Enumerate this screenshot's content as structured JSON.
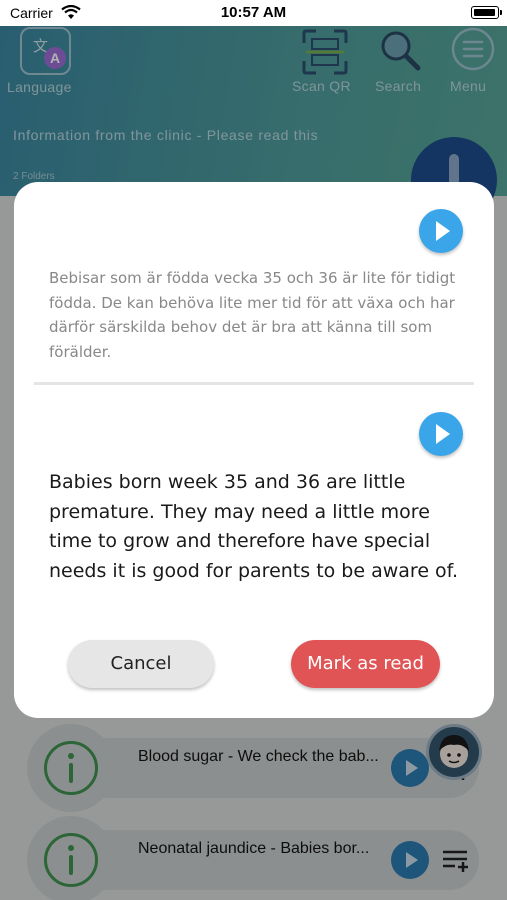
{
  "status_bar": {
    "carrier": "Carrier",
    "time": "10:57 AM"
  },
  "header": {
    "language_label": "Language",
    "language_icon_glyph": "文",
    "language_icon_letter": "A",
    "scan_label": "Scan QR",
    "search_label": "Search",
    "menu_label": "Menu",
    "folder_title": "Information from the clinic - Please read this",
    "folder_count": "2 Folders"
  },
  "modal": {
    "swedish_text": "Bebisar som är födda vecka 35 och 36 är lite för tidigt födda. De kan behöva lite mer tid för att växa och har därför särskilda behov det är bra att känna till som förälder.",
    "english_text": "Babies born week 35 and 36 are little premature. They may need a little more time to grow and therefore have special needs it is good for parents to be aware of.",
    "cancel_label": "Cancel",
    "mark_read_label": "Mark as read"
  },
  "list": {
    "items": [
      {
        "title": "Blood sugar - We check the bab..."
      },
      {
        "title": "Neonatal jaundice - Babies bor..."
      }
    ]
  },
  "colors": {
    "header_gradient_start": "#3b87a1",
    "header_gradient_end": "#57a598",
    "play_button": "#3aa5e8",
    "mark_read_button": "#e05455",
    "cancel_button": "#e6e6e6",
    "info_icon": "#3f9150"
  },
  "icons": [
    "wifi-icon",
    "battery-icon",
    "translate-icon",
    "qr-scan-icon",
    "search-icon",
    "menu-icon",
    "play-icon",
    "info-icon",
    "playlist-add-icon",
    "avatar-icon"
  ]
}
